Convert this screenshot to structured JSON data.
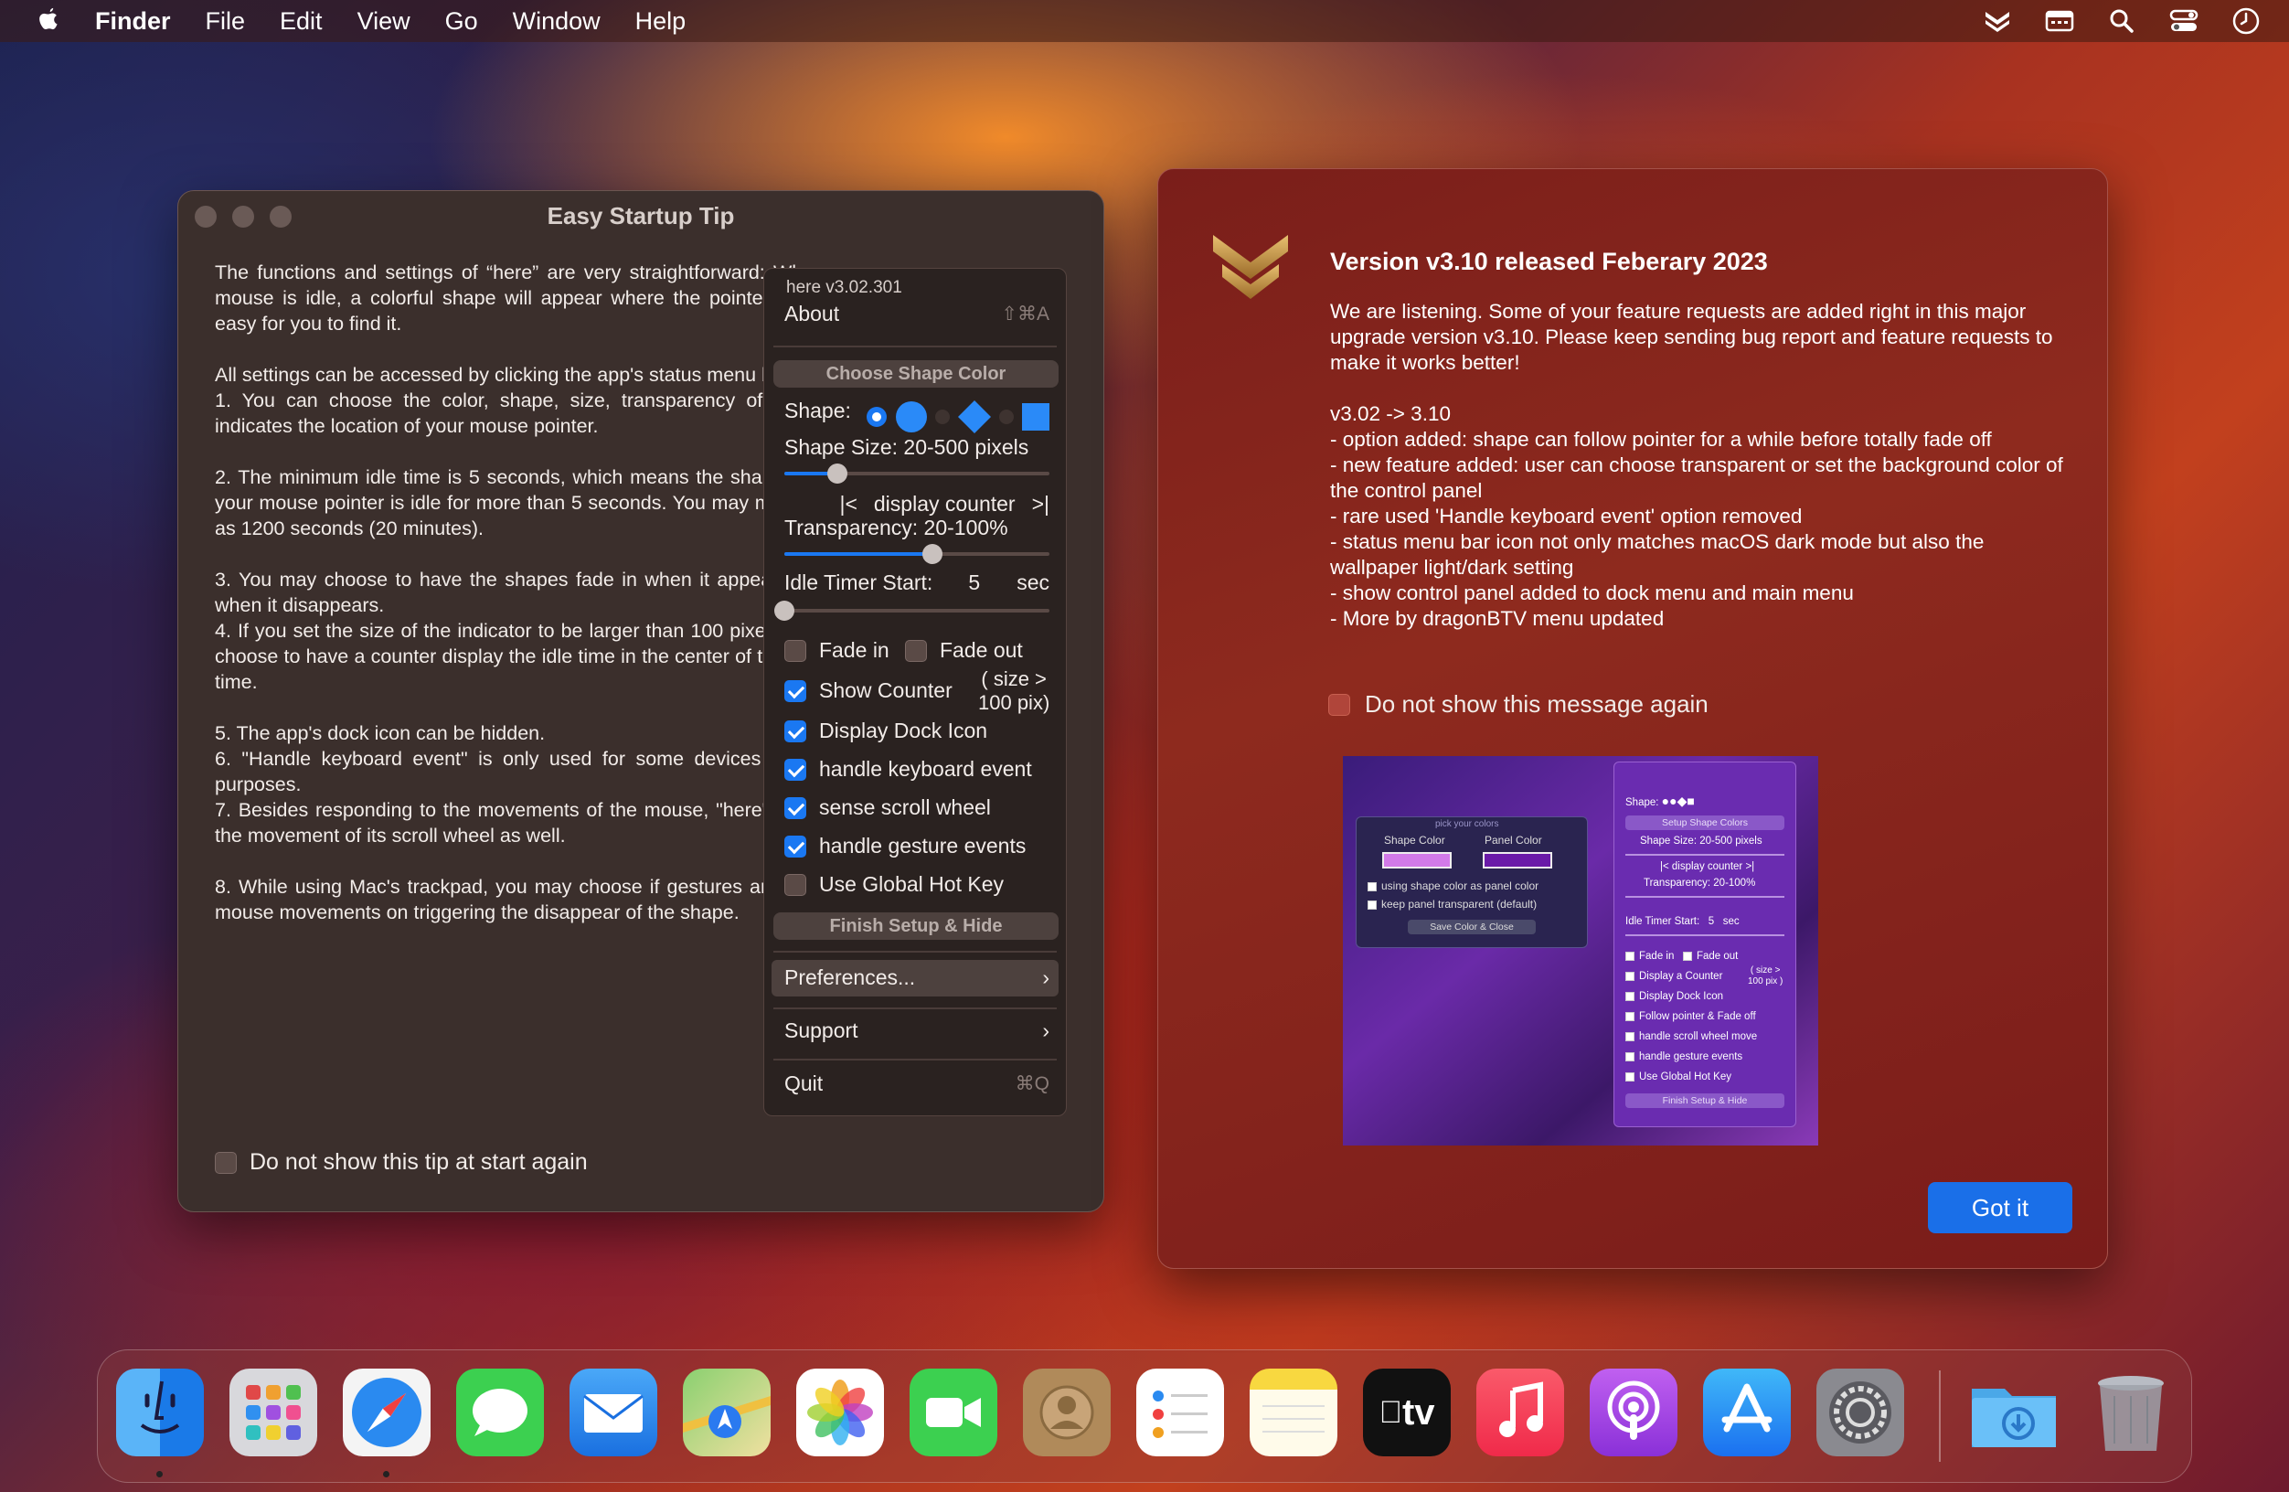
{
  "menubar": {
    "app_name": "Finder",
    "items": [
      "File",
      "Edit",
      "View",
      "Go",
      "Window",
      "Help"
    ],
    "status_icons": [
      "here-chevron-icon",
      "calendar-icon",
      "search-icon",
      "control-center-icon",
      "clock-icon"
    ]
  },
  "tip_window": {
    "title": "Easy Startup Tip",
    "paragraphs": [
      "The functions and settings of “here” are very straightforward: Whenever your mouse is idle, a colorful shape will appear where the pointer is and make it easy for you to find it.",
      "All settings can be accessed by clicking the app's status menu bar icon.",
      "1.  You can choose the color, shape, size, transparency of the shape that indicates the location of your mouse pointer.",
      "2.  The minimum idle time is 5 seconds, which means the shape will pop out if your mouse pointer is idle for more than 5 seconds. You may make this as long as 1200 seconds (20 minutes).",
      "3.  You may choose to have the shapes fade in when it appears and fade out when it disappears.",
      "4.   If you set the size of the indicator to be larger than 100 pixels, you may also choose to have a counter display the idle time in the center of the shape in real-time.",
      "5.  The app's dock icon can be hidden.",
      "6.   \"Handle keyboard event\" is only used for some devices for accessibility purposes.",
      "7.   Besides responding to the movements of the mouse, \"here\" can respond to the movement of its scroll wheel as well.",
      "8.   While using Mac's trackpad, you may choose if gestures are considered as mouse movements on triggering the disappear of the shape."
    ],
    "dont_show_label": "Do not show this tip at start again",
    "dont_show_checked": false
  },
  "menu_panel": {
    "version": "here v3.02.301",
    "about": "About",
    "about_shortcut": "⇧⌘A",
    "choose_color": "Choose Shape Color",
    "shape_label": "Shape:",
    "size_label": "Shape Size: 20-500 pixels",
    "size_value": 0.2,
    "counter_left": "|<",
    "counter_text": "display counter",
    "counter_right": ">|",
    "transparency_label": "Transparency: 20-100%",
    "transparency_value": 0.56,
    "idle_label": "Idle Timer Start:",
    "idle_value": "5",
    "idle_unit": "sec",
    "idle_slider": 0.0,
    "fade_in": "Fade in",
    "fade_in_checked": false,
    "fade_out": "Fade out",
    "fade_out_checked": false,
    "show_counter": "Show Counter",
    "show_counter_checked": true,
    "size_note_1": "( size >",
    "size_note_2": "100 pix)",
    "dock_icon": "Display Dock Icon",
    "dock_icon_checked": true,
    "keyboard": "handle keyboard event",
    "keyboard_checked": true,
    "scroll": "sense scroll wheel",
    "scroll_checked": true,
    "gesture": "handle gesture events",
    "gesture_checked": true,
    "hotkey": "Use Global Hot Key",
    "hotkey_checked": false,
    "finish": "Finish Setup & Hide",
    "preferences": "Preferences...",
    "support": "Support",
    "quit": "Quit",
    "quit_shortcut": "⌘Q"
  },
  "release_window": {
    "title": "Version v3.10 released Feberary 2023",
    "intro": "We are listening. Some of your feature requests are added right in this major upgrade version v3.10. Please keep sending bug report and feature requests to make it works better!",
    "changes": [
      "v3.02 -> 3.10",
      "- option added: shape can follow pointer for a while before totally fade off",
      "- new feature added: user can choose transparent or set the background color of the control panel",
      "- rare used 'Handle keyboard event' option removed",
      "- status menu bar icon not only matches macOS dark mode but also the wallpaper light/dark setting",
      "- show control panel added to dock menu and main menu",
      "- More by dragonBTV menu updated"
    ],
    "dont_show_label": "Do not show this message again",
    "got_it": "Got it",
    "preview": {
      "pick_colors": "pick your colors",
      "shape_color": "Shape Color",
      "panel_color": "Panel Color",
      "opt1": "using shape color as panel color",
      "opt2": "keep panel transparent (default)",
      "save": "Save Color & Close",
      "shape": "Shape:",
      "setup": "Setup Shape Colors",
      "size": "Shape Size: 20-500 pixels",
      "counter": "|<   display counter   >|",
      "transparency": "Transparency: 20-100%",
      "idle": "Idle Timer Start:",
      "idle_val": "5",
      "idle_unit": "sec",
      "fade_in": "Fade in",
      "fade_out": "Fade out",
      "display_counter": "Display a Counter",
      "size_note": "( size >",
      "size_note2": "100 pix )",
      "dock": "Display Dock Icon",
      "follow": "Follow pointer & Fade off",
      "scroll": "handle scroll wheel move",
      "gesture": "handle gesture events",
      "hotkey": "Use Global Hot Key",
      "finish": "Finish Setup & Hide"
    }
  },
  "dock": {
    "apps": [
      "Finder",
      "Launchpad",
      "Safari",
      "Messages",
      "Mail",
      "Maps",
      "Photos",
      "FaceTime",
      "Contacts",
      "Reminders",
      "Notes",
      "Apple TV",
      "Music",
      "Podcasts",
      "App Store",
      "System Settings"
    ],
    "extras": [
      "Downloads",
      "Trash"
    ],
    "tv_label": "tv"
  },
  "colors": {
    "accent_blue": "#1a78f2",
    "window_bg": "#3b2f2c",
    "release_bg": "#8e2a1e"
  }
}
